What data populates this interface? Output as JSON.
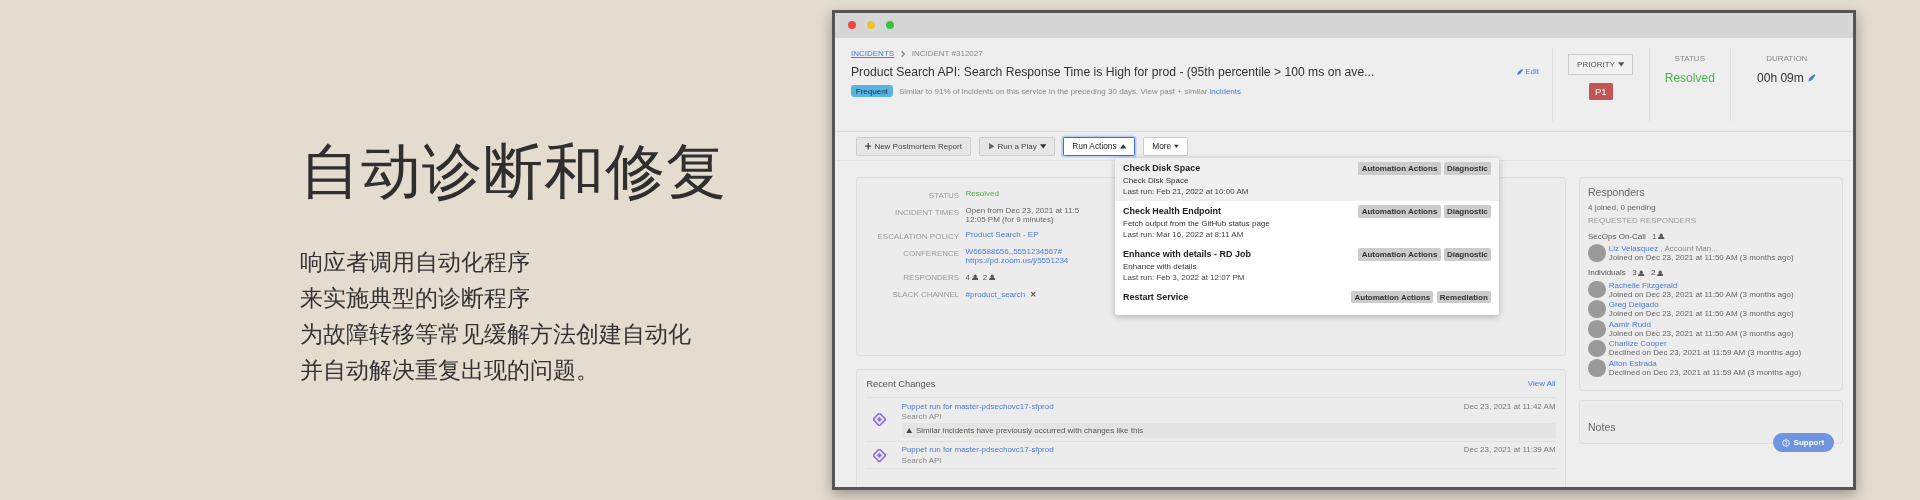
{
  "hero": {
    "title": "自动诊断和修复",
    "lines": [
      "响应者调用自动化程序",
      "来实施典型的诊断程序",
      "为故障转移等常见缓解方法创建自动化",
      "并自动解决重复出现的问题。"
    ]
  },
  "app": {
    "breadcrumb": [
      "INCIDENTS",
      "INCIDENT #312027"
    ],
    "incident_title": "Product Search API: Search Response Time is High for prod - (95th percentile > 100 ms on ave...",
    "edit_link": "Edit",
    "tag": "Frequent",
    "similarity_note": "Similar to 91% of incidents on this service in the preceding 30 days. View past + similar",
    "similarity_link": "incidents",
    "priority": {
      "label": "PRIORITY",
      "value": "P1"
    },
    "status": {
      "label": "STATUS",
      "value": "Resolved"
    },
    "duration": {
      "label": "DURATION",
      "value": "00h 09m"
    },
    "toolbar": [
      {
        "label": "New Postmortem Report",
        "kind": "add",
        "expanded": false
      },
      {
        "label": "Run a Play",
        "kind": "play",
        "expanded": false
      },
      {
        "label": "Run Actions",
        "kind": "menu",
        "expanded": true
      },
      {
        "label": "More",
        "kind": "menu",
        "expanded": false
      }
    ],
    "details": [
      {
        "label": "STATUS",
        "kind": "status",
        "lines": [
          "Resolved"
        ]
      },
      {
        "label": "INCIDENT TIMES",
        "kind": "text",
        "lines": [
          "Open from Dec 23, 2021 at 11:5",
          "12:05 PM (for 9 minutes)"
        ]
      },
      {
        "label": "ESCALATION POLICY",
        "kind": "link",
        "lines": [
          "Product Search - EP"
        ]
      },
      {
        "label": "CONFERENCE",
        "kind": "link",
        "lines": [
          "W66588656,,5551234567#",
          "https://pd.zoom.us/j/5551234"
        ]
      },
      {
        "label": "RESPONDERS",
        "kind": "counts",
        "lines": [
          "4",
          "2"
        ]
      },
      {
        "label": "SLACK CHANNEL",
        "kind": "channel",
        "lines": [
          "#product_search"
        ]
      }
    ],
    "actions_menu": [
      {
        "name": "Check Disk Space",
        "description": "Check Disk Space",
        "last_run": "Last run: Feb 21, 2022 at 10:00 AM",
        "tags": [
          "Automation Actions",
          "Diagnostic"
        ],
        "selected": true
      },
      {
        "name": "Check Health Endpoint",
        "description": "Fetch output from the GitHub status page",
        "last_run": "Last run: Mar 16, 2022 at 8:11 AM",
        "tags": [
          "Automation Actions",
          "Diagnostic"
        ],
        "selected": false
      },
      {
        "name": "Enhance with details - RD Job",
        "description": "Enhance with details",
        "last_run": "Last run: Feb 3, 2022 at 12:07 PM",
        "tags": [
          "Automation Actions",
          "Diagnostic"
        ],
        "selected": false
      },
      {
        "name": "Restart Service",
        "tags": [
          "Automation Actions",
          "Remediation"
        ],
        "selected": false
      }
    ],
    "recent_changes": {
      "title": "Recent Changes",
      "view_all": "View All",
      "items": [
        {
          "title": "Puppet run for master-pdsechovc17-sfprod",
          "service": "Search API",
          "time": "Dec 23, 2021 at 11:42 AM",
          "warning": "Similar incidents have previously occurred with changes like this"
        },
        {
          "title": "Puppet run for master-pdsechovc17-sfprod",
          "service": "Search API",
          "time": "Dec 23, 2021 at 11:39 AM"
        }
      ]
    },
    "responders": {
      "title": "Responders",
      "summary": "4 joined, 0 pending",
      "section_label": "REQUESTED RESPONDERS",
      "groups": [
        {
          "name": "SecOps On-Call",
          "counts": [
            "1"
          ],
          "people": [
            {
              "name": "Liz Velasquez",
              "role": ", Account Man...",
              "status": "Joined on Dec 23, 2021 at 11:50 AM (3 months ago)"
            }
          ]
        },
        {
          "name": "Individuals",
          "counts": [
            "3",
            "2"
          ],
          "people": [
            {
              "name": "Rachelle Fitzgerald",
              "status": "Joined on Dec 23, 2021 at 11:50 AM (3 months ago)"
            },
            {
              "name": "Greg Delgado",
              "status": "Joined on Dec 23, 2021 at 11:50 AM (3 months ago)"
            },
            {
              "name": "Aamir Rudd",
              "status": "Joined on Dec 23, 2021 at 11:50 AM (3 months ago)"
            },
            {
              "name": "Charlize Cooper",
              "status": "Declined on Dec 23, 2021 at 11:59 AM (3 months ago)"
            },
            {
              "name": "Alton Estrada",
              "status": "Declined on Dec 23, 2021 at 11:59 AM (3 months ago)"
            }
          ]
        }
      ]
    },
    "notes_title": "Notes",
    "support_button": "Support"
  }
}
